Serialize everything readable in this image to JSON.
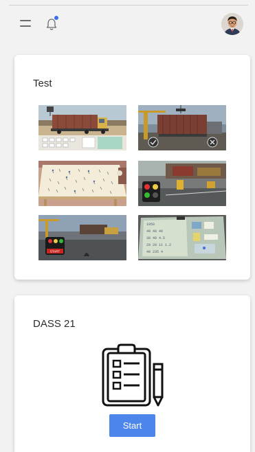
{
  "header": {
    "icons": [
      "menu-icon",
      "bell-icon",
      "avatar"
    ],
    "notification_dot_color": "#3b6ef0"
  },
  "test_card": {
    "title": "Test",
    "thumbnails": [
      {
        "name": "truck-container-scene"
      },
      {
        "name": "crane-container-scene"
      },
      {
        "name": "table-markers-scene"
      },
      {
        "name": "traffic-light-scene"
      },
      {
        "name": "port-start-scene"
      },
      {
        "name": "blueprint-board-scene"
      }
    ],
    "thumb_text": {
      "start": "START",
      "board_lines": [
        "1950",
        "40 40 40",
        "30 40 4.5",
        "29 28 11 1.2",
        "40 235 4"
      ]
    }
  },
  "dass_card": {
    "title": "DASS 21",
    "icon": "clipboard-checklist-icon",
    "start_label": "Start",
    "button_color": "#4d86ea"
  }
}
